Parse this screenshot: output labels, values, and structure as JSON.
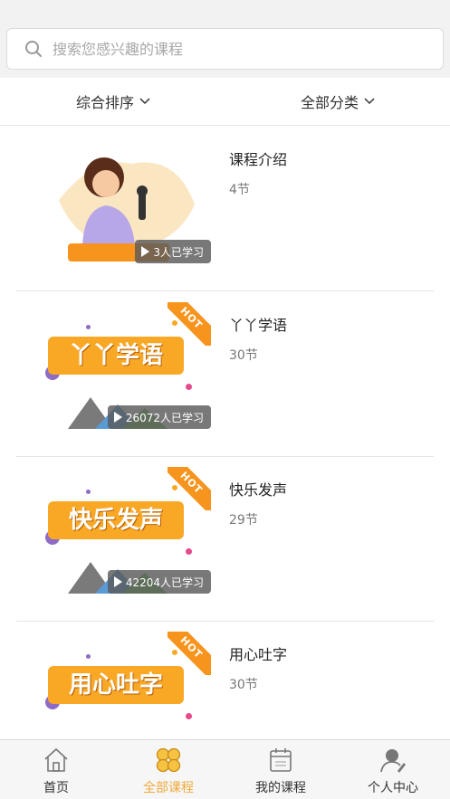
{
  "search": {
    "placeholder": "搜索您感兴趣的课程"
  },
  "filters": {
    "sort_label": "综合排序",
    "category_label": "全部分类"
  },
  "courses": [
    {
      "title": "课程介绍",
      "lessons": "4节",
      "learners": "3人已学习",
      "hot": false,
      "banner": ""
    },
    {
      "title": "丫丫学语",
      "lessons": "30节",
      "learners": "26072人已学习",
      "hot": true,
      "banner": "丫丫学语"
    },
    {
      "title": "快乐发声",
      "lessons": "29节",
      "learners": "42204人已学习",
      "hot": true,
      "banner": "快乐发声"
    },
    {
      "title": "用心吐字",
      "lessons": "30节",
      "learners": "",
      "hot": true,
      "banner": "用心吐字"
    }
  ],
  "hot_label": "HOT",
  "tabbar": {
    "items": [
      {
        "label": "首页",
        "icon": "home-icon"
      },
      {
        "label": "全部课程",
        "icon": "all-courses-icon"
      },
      {
        "label": "我的课程",
        "icon": "calendar-icon"
      },
      {
        "label": "个人中心",
        "icon": "user-icon"
      }
    ],
    "active_color": "#f0a93a"
  },
  "colors": {
    "accent": "#f7941d",
    "banner": "#f9a826"
  }
}
